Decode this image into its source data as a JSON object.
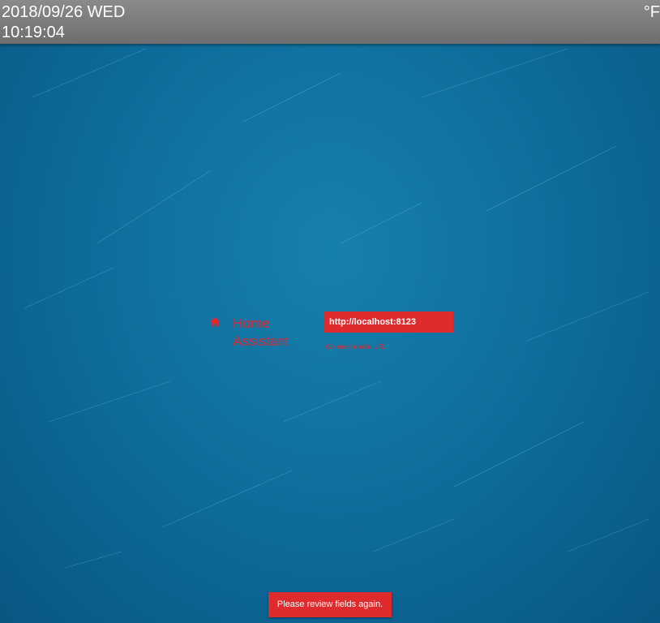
{
  "status_bar": {
    "date": "2018/09/26 WED",
    "time": "10:19:04",
    "temperature_unit": "°F"
  },
  "login": {
    "brand_line1": "Home",
    "brand_line2": "Assistant",
    "brand_icon": "home-icon",
    "url_value": "http://localhost:8123",
    "error_message": "We need a valid URL."
  },
  "toast": {
    "message": "Please review fields again."
  },
  "colors": {
    "background": "#0f6f9e",
    "accent_error": "#e02b2e",
    "topbar": "#7a7a7a"
  }
}
